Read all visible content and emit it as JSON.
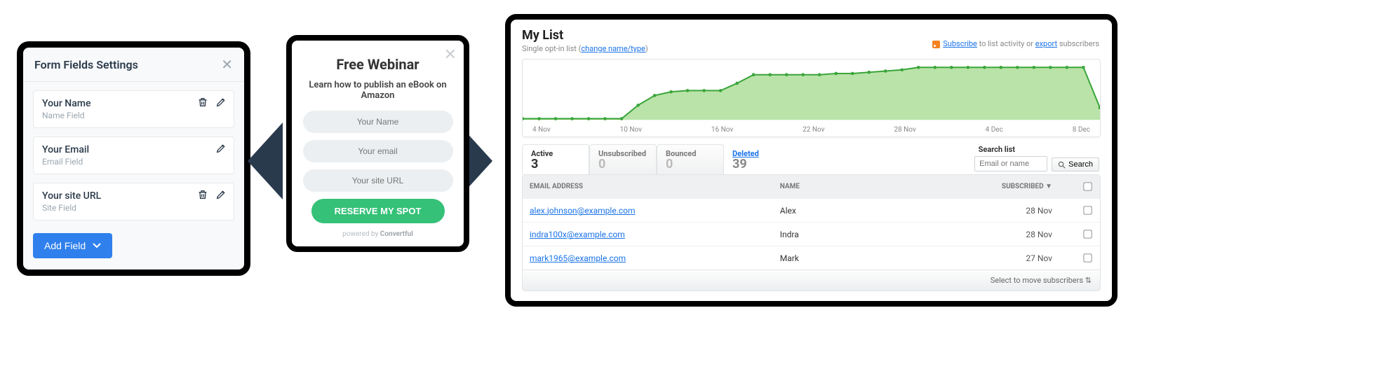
{
  "panel1": {
    "title": "Form Fields Settings",
    "fields": [
      {
        "label": "Your Name",
        "sub": "Name Field",
        "trash": true,
        "edit": true
      },
      {
        "label": "Your Email",
        "sub": "Email Field",
        "trash": false,
        "edit": true
      },
      {
        "label": "Your site URL",
        "sub": "Site Field",
        "trash": true,
        "edit": true
      }
    ],
    "add": "Add Field"
  },
  "panel2": {
    "title": "Free Webinar",
    "subtitle": "Learn how to publish an eBook on Amazon",
    "ph_name": "Your Name",
    "ph_email": "Your email",
    "ph_url": "Your site URL",
    "cta": "RESERVE MY SPOT",
    "powered_prefix": "powered by ",
    "powered_brand": "Convertful"
  },
  "panel3": {
    "title": "My List",
    "subtitle_prefix": "Single opt-in list (",
    "subtitle_link": "change name/type",
    "subtitle_suffix": ")",
    "top_links": {
      "subscribe": "Subscribe",
      "mid": " to list activity or ",
      "export": "export",
      "tail": " subscribers"
    },
    "tabs": [
      {
        "label": "Active",
        "count": "3",
        "kind": "active"
      },
      {
        "label": "Unsubscribed",
        "count": "0",
        "kind": "std"
      },
      {
        "label": "Bounced",
        "count": "0",
        "kind": "std"
      },
      {
        "label": "Deleted",
        "count": "39",
        "kind": "del"
      }
    ],
    "search": {
      "label": "Search list",
      "placeholder": "Email or name",
      "button": "Search"
    },
    "columns": {
      "email": "EMAIL ADDRESS",
      "name": "NAME",
      "subscribed": "SUBSCRIBED ▼"
    },
    "rows": [
      {
        "email": "alex.johnson@example.com",
        "name": "Alex",
        "subscribed": "28 Nov"
      },
      {
        "email": "indra100x@example.com",
        "name": "Indra",
        "subscribed": "28 Nov"
      },
      {
        "email": "mark1965@example.com",
        "name": "Mark",
        "subscribed": "27 Nov"
      }
    ],
    "footer": "Select to move subscribers ⇅",
    "xaxis": [
      "4 Nov",
      "10 Nov",
      "16 Nov",
      "22 Nov",
      "28 Nov",
      "4 Dec",
      "8 Dec"
    ]
  },
  "chart_data": {
    "type": "area",
    "title": "Subscriber activity over time",
    "xlabel": "",
    "ylabel": "",
    "ylim": [
      0,
      46
    ],
    "x": [
      "4 Nov",
      "5 Nov",
      "6 Nov",
      "7 Nov",
      "8 Nov",
      "9 Nov",
      "10 Nov",
      "11 Nov",
      "12 Nov",
      "13 Nov",
      "14 Nov",
      "15 Nov",
      "16 Nov",
      "17 Nov",
      "18 Nov",
      "19 Nov",
      "20 Nov",
      "21 Nov",
      "22 Nov",
      "23 Nov",
      "24 Nov",
      "25 Nov",
      "26 Nov",
      "27 Nov",
      "28 Nov",
      "29 Nov",
      "30 Nov",
      "1 Dec",
      "2 Dec",
      "3 Dec",
      "4 Dec",
      "5 Dec",
      "6 Dec",
      "7 Dec",
      "8 Dec",
      "9 Dec"
    ],
    "values": [
      1,
      1,
      1,
      1,
      1,
      1,
      1,
      12,
      20,
      23,
      24,
      24,
      24,
      30,
      37,
      37,
      37,
      37,
      37,
      38,
      38,
      39,
      40,
      41,
      43,
      43,
      43,
      43,
      43,
      43,
      43,
      43,
      43,
      43,
      43,
      10
    ]
  }
}
